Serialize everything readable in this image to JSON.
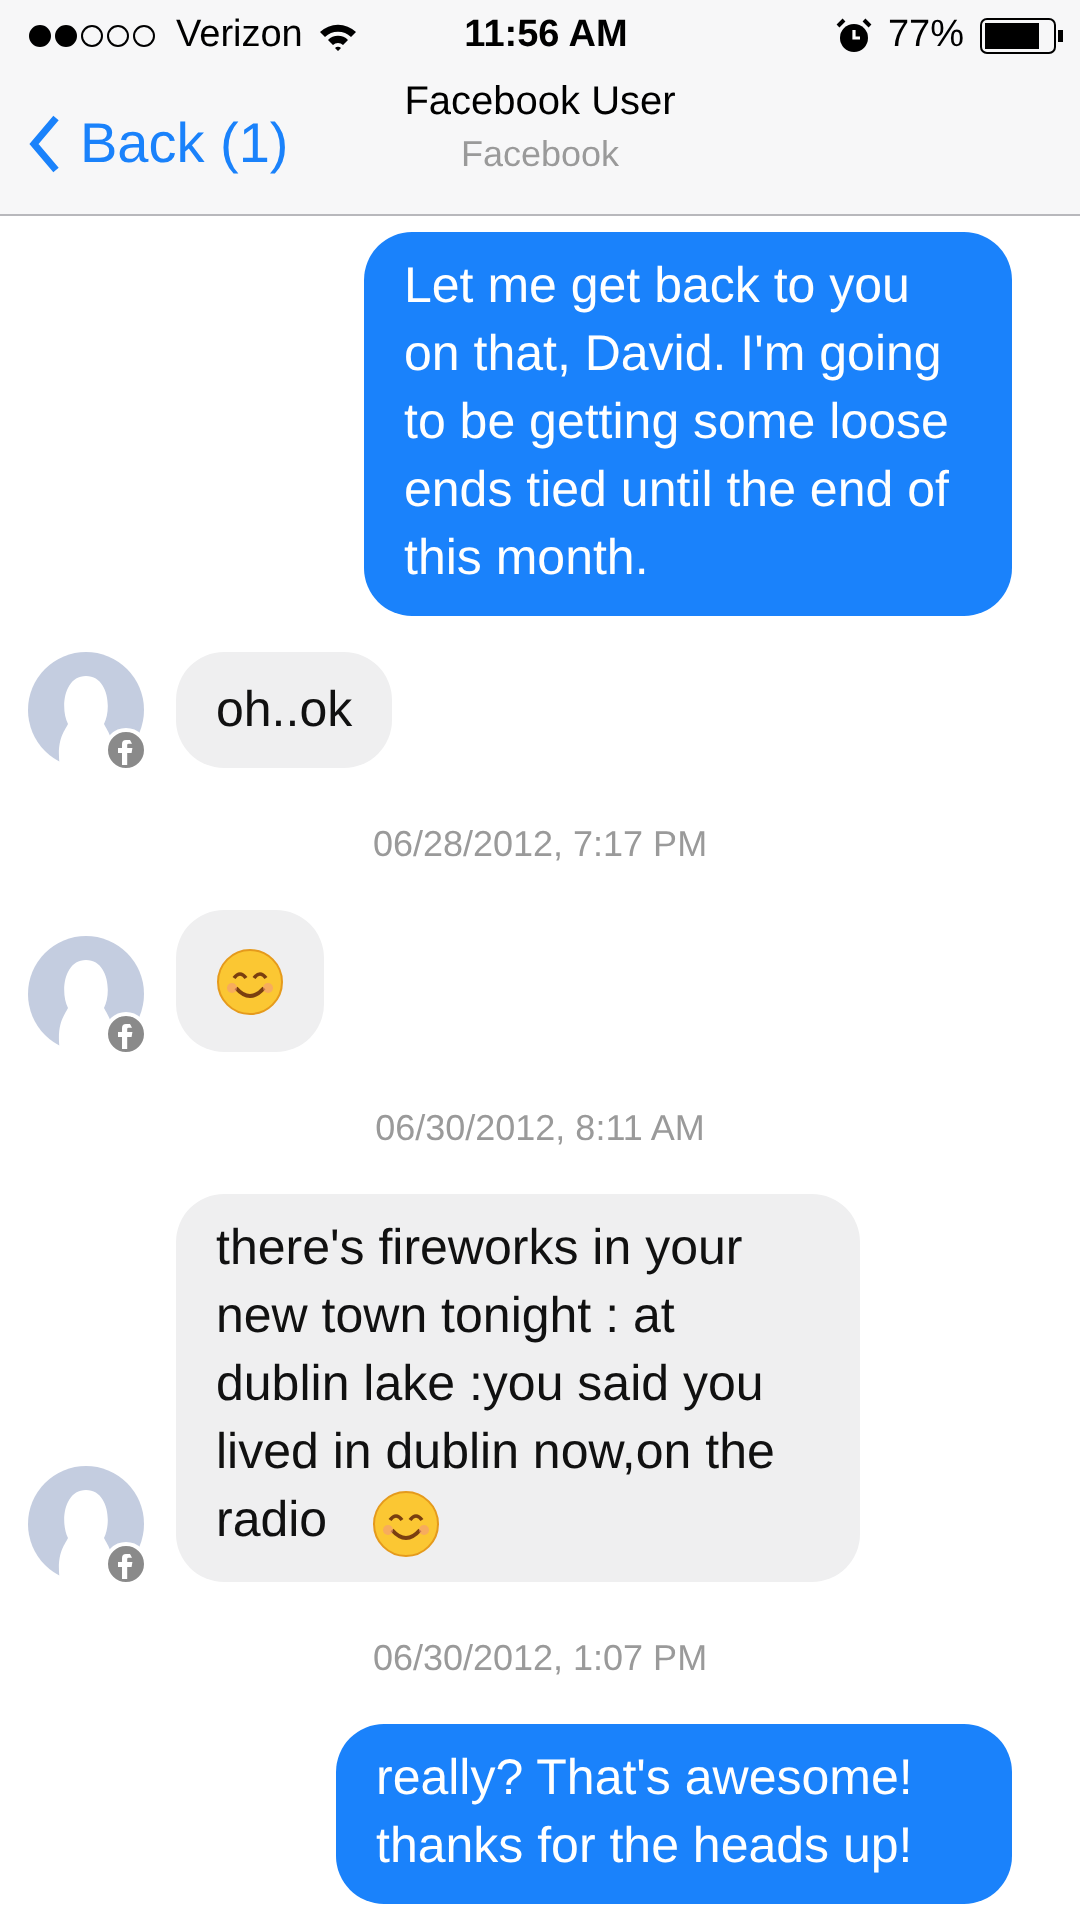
{
  "status_bar": {
    "carrier": "Verizon",
    "time": "11:56 AM",
    "battery": "77%"
  },
  "nav": {
    "back": "Back (1)",
    "title": "Facebook User",
    "subtitle": "Facebook"
  },
  "messages": [
    {
      "kind": "sent",
      "text": "Let me get back to you on that, David. I'm going to be getting some loose ends tied until the end of this month."
    },
    {
      "kind": "received",
      "text": "oh..ok",
      "emoji": false
    },
    {
      "kind": "timestamp",
      "text": "06/28/2012, 7:17 PM"
    },
    {
      "kind": "received",
      "emoji": true
    },
    {
      "kind": "timestamp",
      "text": "06/30/2012, 8:11 AM"
    },
    {
      "kind": "received",
      "text": "there's fireworks in your new town tonight : at dublin lake :you said you lived in dublin now,on the radio",
      "emoji": true
    },
    {
      "kind": "timestamp",
      "text": "06/30/2012, 1:07 PM"
    },
    {
      "kind": "sent",
      "text": "really? That's awesome! thanks for the heads up!"
    }
  ]
}
